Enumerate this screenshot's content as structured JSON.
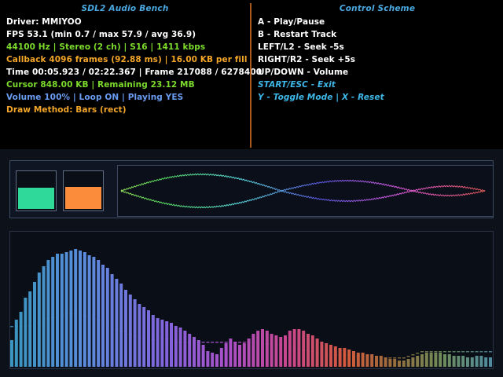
{
  "info": {
    "title": "SDL2 Audio Bench",
    "lines": [
      {
        "text": "Driver: MMIYOO",
        "color": "#ffffff"
      },
      {
        "text": "FPS 53.1 (min 0.7 / max 57.9 / avg 36.9)",
        "color": "#ffffff"
      },
      {
        "text": "44100 Hz | Stereo (2 ch) | S16 | 1411 kbps",
        "color": "#7cdc2c"
      },
      {
        "text": "Callback 4096 frames (92.88 ms) | 16.00 KB per fill",
        "color": "#f4a628"
      },
      {
        "text": "Time 00:05.923 / 02:22.367 | Frame 217088 / 6278400",
        "color": "#ffffff"
      },
      {
        "text": "Cursor 848.00 KB | Remaining 23.12 MB",
        "color": "#7cdc2c"
      },
      {
        "text": "Volume 100% | Loop ON | Playing YES",
        "color": "#6a9cf2"
      },
      {
        "text": "Draw Method: Bars (rect)",
        "color": "#f4a628"
      }
    ]
  },
  "controls": {
    "title": "Control Scheme",
    "lines": [
      {
        "text": "A - Play/Pause",
        "color": "#ffffff",
        "italic": false
      },
      {
        "text": "B - Restart Track",
        "color": "#ffffff",
        "italic": false
      },
      {
        "text": "LEFT/L2 - Seek -5s",
        "color": "#ffffff",
        "italic": false
      },
      {
        "text": "RIGHT/R2 - Seek +5s",
        "color": "#ffffff",
        "italic": false
      },
      {
        "text": "UP/DOWN - Volume",
        "color": "#ffffff",
        "italic": false
      },
      {
        "text": "START/ESC - Exit",
        "color": "#3eb8e8",
        "italic": true
      },
      {
        "text": "Y - Toggle Mode | X - Reset",
        "color": "#3eb8e8",
        "italic": true
      }
    ]
  },
  "meters": {
    "left": {
      "level": 0.58,
      "color": "#2fd99a"
    },
    "right": {
      "level": 0.6,
      "color": "#fb8c3c"
    }
  },
  "colors": {
    "divider": "#a85a1e",
    "title": "#4aa8e0"
  },
  "spectrum": {
    "bars": [
      34,
      60,
      70,
      88,
      96,
      108,
      120,
      128,
      136,
      140,
      144,
      144,
      146,
      148,
      150,
      148,
      146,
      142,
      140,
      136,
      130,
      126,
      118,
      112,
      106,
      98,
      92,
      86,
      80,
      76,
      72,
      66,
      62,
      60,
      58,
      56,
      52,
      50,
      46,
      42,
      38,
      34,
      28,
      20,
      18,
      16,
      24,
      30,
      36,
      32,
      28,
      30,
      36,
      42,
      46,
      48,
      46,
      42,
      40,
      38,
      40,
      46,
      48,
      48,
      46,
      42,
      40,
      36,
      32,
      30,
      28,
      26,
      24,
      24,
      22,
      20,
      18,
      18,
      16,
      16,
      14,
      14,
      12,
      10,
      10,
      8,
      8,
      10,
      12,
      14,
      16,
      18,
      18,
      18,
      18,
      16,
      16,
      14,
      14,
      14,
      12,
      12,
      14,
      14,
      12,
      12
    ],
    "peaks": [
      50,
      50,
      50,
      50,
      50,
      52,
      54,
      56,
      60,
      62,
      64,
      64,
      66,
      66,
      66,
      66,
      64,
      62,
      60,
      58,
      56,
      52,
      48,
      46,
      44,
      42,
      40,
      38,
      36,
      34,
      33,
      33,
      34,
      35,
      34,
      32,
      30,
      30,
      30,
      30,
      30,
      30,
      30,
      30,
      30,
      30,
      30,
      30,
      30,
      30,
      30,
      30,
      30,
      30,
      28,
      28,
      28,
      28,
      28,
      26,
      26,
      24,
      22,
      22,
      20,
      18,
      18,
      16,
      16,
      14,
      14,
      14,
      14,
      14,
      14,
      14,
      12,
      12,
      12,
      12,
      10,
      10,
      10,
      10,
      10,
      10,
      10,
      12,
      14,
      16,
      18,
      18,
      18,
      18,
      18,
      18,
      18,
      18,
      18,
      18,
      18,
      18,
      18,
      18,
      18,
      18
    ]
  }
}
